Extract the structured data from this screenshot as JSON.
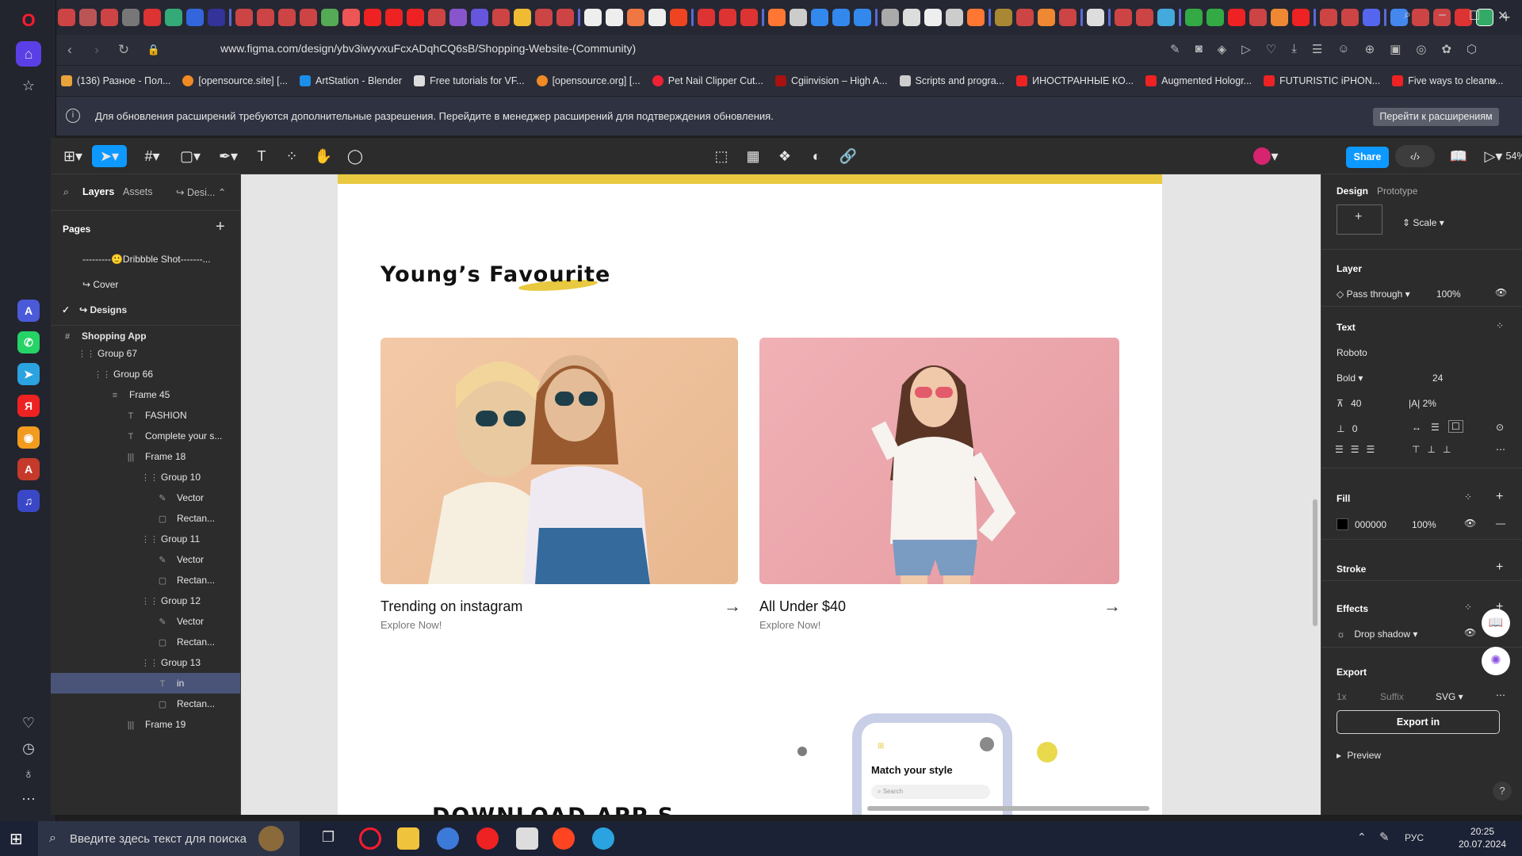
{
  "browser": {
    "url": "www.figma.com/design/ybv3iwyvxuFcxADqhCQ6sB/Shopping-Website-(Community)",
    "bookmarks": [
      "(136) Разное - Пол...",
      "[opensource.site] [...",
      "ArtStation - Blender",
      "Free tutorials for VF...",
      "[opensource.org] [...",
      "Pet Nail Clipper Cut...",
      "Cgiinvision – High A...",
      "Scripts and progra...",
      "ИНОСТРАННЫЕ КО...",
      "Augmented Hologr...",
      "FUTURISTIC iPHON...",
      "Five ways to cleanu..."
    ],
    "info_message": "Для обновления расширений требуются дополнительные разрешения. Перейдите в менеджер расширений для подтверждения обновления.",
    "info_button": "Перейти к расширениям"
  },
  "figma": {
    "share_label": "Share",
    "zoom": "54%",
    "left_tabs": {
      "layers": "Layers",
      "assets": "Assets",
      "design": "Desi..."
    },
    "pages_title": "Pages",
    "pages": [
      {
        "label": "---------🙂Dribbble Shot-------..."
      },
      {
        "label": "↪ Cover"
      },
      {
        "label": "↪ Designs"
      }
    ],
    "layers": [
      {
        "label": "Shopping App",
        "icon": "#",
        "indent": 0
      },
      {
        "label": "Group 67",
        "icon": "⋮⋮",
        "indent": 1
      },
      {
        "label": "Group 66",
        "icon": "⋮⋮",
        "indent": 2
      },
      {
        "label": "Frame 45",
        "icon": "≡",
        "indent": 3
      },
      {
        "label": "FASHION",
        "icon": "T",
        "indent": 4
      },
      {
        "label": "Complete your s...",
        "icon": "T",
        "indent": 4
      },
      {
        "label": "Frame 18",
        "icon": "|||",
        "indent": 4
      },
      {
        "label": "Group 10",
        "icon": "⋮⋮",
        "indent": 5
      },
      {
        "label": "Vector",
        "icon": "✎",
        "indent": 6
      },
      {
        "label": "Rectan...",
        "icon": "▢",
        "indent": 6
      },
      {
        "label": "Group 11",
        "icon": "⋮⋮",
        "indent": 5
      },
      {
        "label": "Vector",
        "icon": "✎",
        "indent": 6
      },
      {
        "label": "Rectan...",
        "icon": "▢",
        "indent": 6
      },
      {
        "label": "Group 12",
        "icon": "⋮⋮",
        "indent": 5
      },
      {
        "label": "Vector",
        "icon": "✎",
        "indent": 6
      },
      {
        "label": "Rectan...",
        "icon": "▢",
        "indent": 6
      },
      {
        "label": "Group 13",
        "icon": "⋮⋮",
        "indent": 5
      },
      {
        "label": "in",
        "icon": "T",
        "indent": 6
      },
      {
        "label": "Rectan...",
        "icon": "▢",
        "indent": 6
      },
      {
        "label": "Frame 19",
        "icon": "|||",
        "indent": 4
      }
    ],
    "selected_layer": "in",
    "right": {
      "tab_design": "Design",
      "tab_prototype": "Prototype",
      "constraint": "Scale",
      "layer_title": "Layer",
      "blend": "Pass through",
      "opacity": "100%",
      "text_title": "Text",
      "font": "Roboto",
      "weight": "Bold",
      "size": "24",
      "line_height": "40",
      "letter_spacing": "2%",
      "paragraph": "0",
      "fill_title": "Fill",
      "fill_hex": "000000",
      "fill_opacity": "100%",
      "stroke_title": "Stroke",
      "effects_title": "Effects",
      "effect": "Drop shadow",
      "export_title": "Export",
      "export_scale": "1x",
      "export_suffix": "Suffix",
      "export_format": "SVG",
      "export_button": "Export in",
      "preview": "Preview"
    }
  },
  "design_frame": {
    "section_title": "Young’s Favourite",
    "cards": [
      {
        "title": "Trending on instagram",
        "sub": "Explore Now!"
      },
      {
        "title": "All Under $40",
        "sub": "Explore Now!"
      }
    ],
    "download_title": "DOWNLOAD APP S",
    "phone_heading": "Match your style",
    "phone_search": "Search"
  },
  "taskbar": {
    "search_placeholder": "Введите здесь текст для поиска",
    "lang": "РУС",
    "time": "20:25",
    "date": "20.07.2024"
  },
  "colors": {
    "accent": "#0d99ff",
    "brand_yellow": "#e8c93f"
  }
}
